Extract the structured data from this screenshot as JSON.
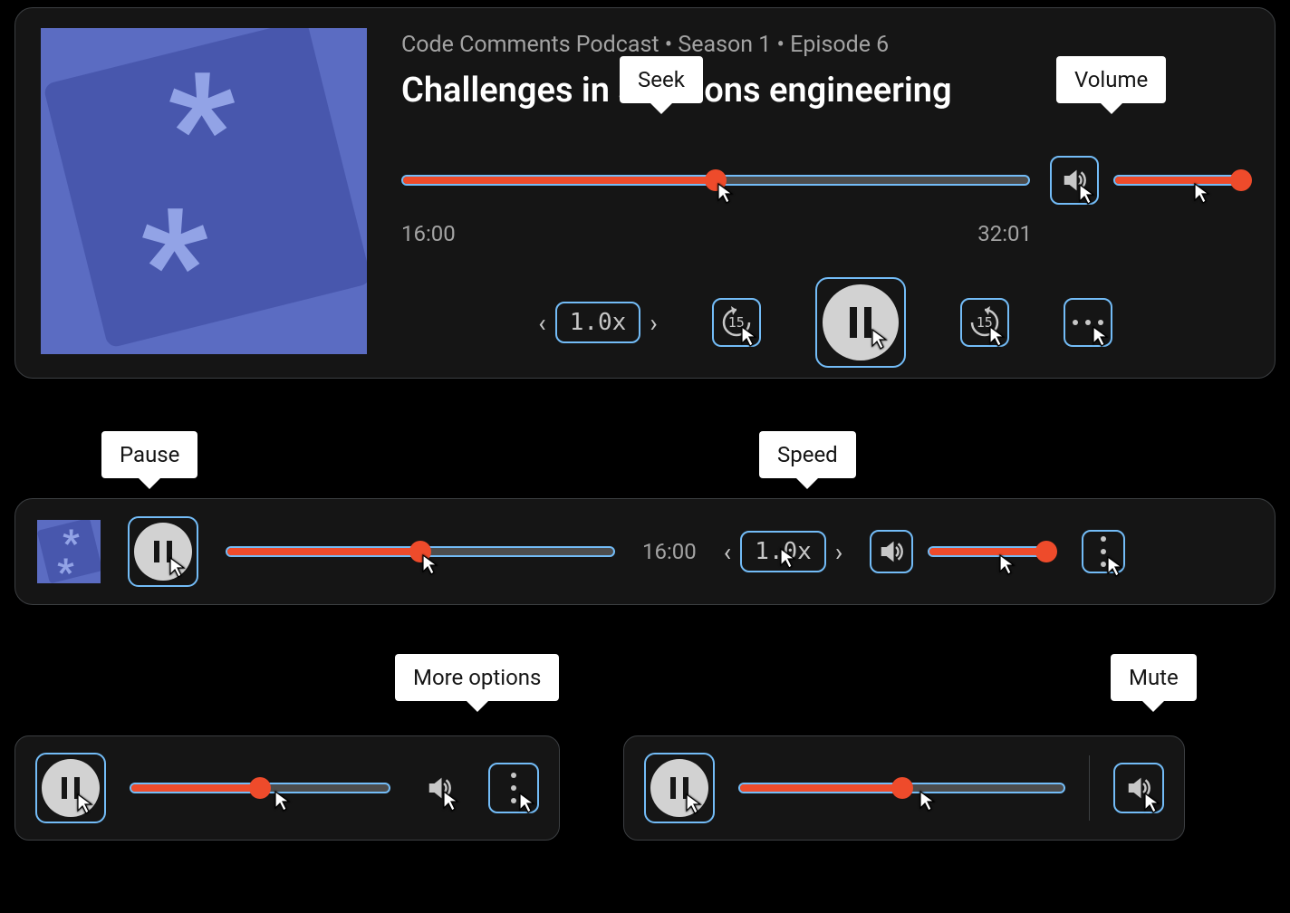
{
  "large": {
    "subtitle": "Code Comments Podcast • Season 1 • Episode 6",
    "title": "Challenges in solutions engineering",
    "time_current": "16:00",
    "time_total": "32:01",
    "seek_percent": 50,
    "volume_percent": 95,
    "speed": "1.0x",
    "skip_back": "15",
    "skip_fwd": "15"
  },
  "medium": {
    "seek_percent": 50,
    "time_current": "16:00",
    "speed": "1.0x",
    "volume_percent": 95
  },
  "mini1": {
    "seek_percent": 50
  },
  "mini2": {
    "seek_percent": 50
  },
  "tooltips": {
    "seek": "Seek",
    "volume": "Volume",
    "pause": "Pause",
    "speed": "Speed",
    "more": "More options",
    "mute": "Mute"
  }
}
